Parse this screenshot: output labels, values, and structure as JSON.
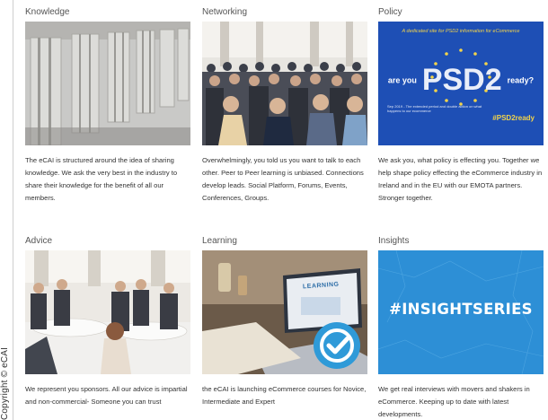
{
  "copyright": "Copyright © eCAI",
  "cards": [
    {
      "title": "Knowledge",
      "text": "The eCAI is structured around the idea of sharing knowledge. We ask the very best in the industry to share their knowledge for the benefit of all our members."
    },
    {
      "title": "Networking",
      "text": "Overwhelmingly, you told us you want to talk to each other. Peer to Peer learning is unbiased. Connections develop leads. Social Platform, Forums, Events, Conferences, Groups."
    },
    {
      "title": "Policy",
      "text": "We ask you, what policy is effecting you. Together we help shape policy effecting the eCommerce industry in Ireland and in the EU with our EMOTA partners. Stronger together."
    },
    {
      "title": "Advice",
      "text": "We represent you sponsors. All our advice is impartial and non-commercial- Someone you can trust"
    },
    {
      "title": "Learning",
      "text": "the eCAI is launching eCommerce courses for Novice, Intermediate and Expert"
    },
    {
      "title": "Insights",
      "text": "We get real interviews with movers and shakers in eCommerce. Keeping up to date with latest developments."
    }
  ],
  "psd2_image": {
    "tagline": "A dedicated site for PSD2 information for eCommerce",
    "prefix": "are you",
    "headline": "PSD2",
    "suffix": "ready?",
    "fine_print": "Sep 2019 - The extended period and double action on what happens to our ecommerce",
    "hashtag": "#PSD2ready"
  },
  "insight_image": {
    "hashtag": "#INSIGHTSERIES"
  },
  "learning_image": {
    "screen_text": "LEARNING"
  }
}
